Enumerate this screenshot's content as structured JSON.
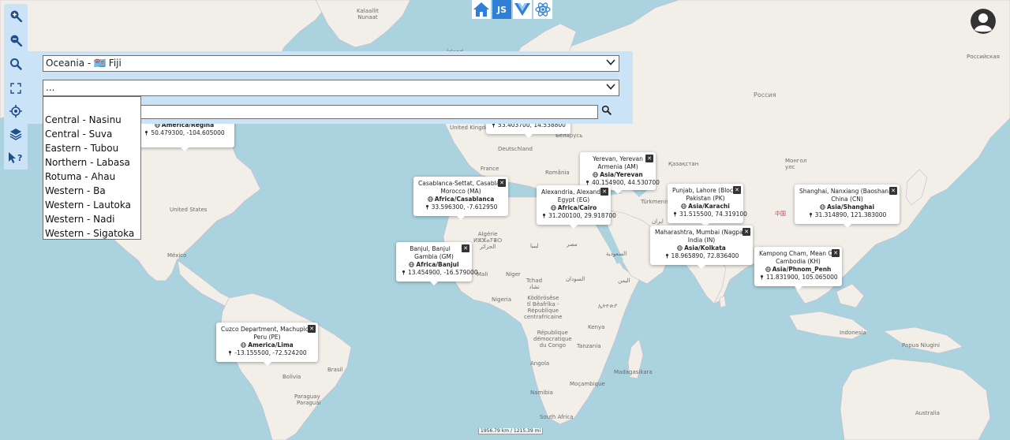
{
  "top_icons": [
    {
      "name": "home-icon"
    },
    {
      "name": "javascript-icon",
      "label": "JS"
    },
    {
      "name": "vue-icon"
    },
    {
      "name": "react-icon"
    }
  ],
  "panel": {
    "region_select_value": "Oceania - 🇫🇯 Fiji",
    "subregion_select_value": "...",
    "search_value": ""
  },
  "dropdown": {
    "options": [
      "Central - Nasinu",
      "Central - Suva",
      "Eastern - Tubou",
      "Northern - Labasa",
      "Rotuma - Ahau",
      "Western - Ba",
      "Western - Lautoka",
      "Western - Nadi",
      "Western - Sigatoka"
    ]
  },
  "popups": [
    {
      "id": "regina",
      "title": "",
      "tz": "America/Regina",
      "coords": "50.479300, -104.605000"
    },
    {
      "id": "europe",
      "title": "",
      "tz": "",
      "coords": "53.403700, 14.538800"
    },
    {
      "id": "yerevan",
      "title": "Yerevan, Yerevan",
      "country": "Armenia (AM)",
      "tz": "Asia/Yerevan",
      "coords": "40.154900, 44.530700"
    },
    {
      "id": "casablanca",
      "title": "Casablanca-Settat, Casablanca",
      "country": "Morocco (MA)",
      "tz": "Africa/Casablanca",
      "coords": "33.596300, -7.612950"
    },
    {
      "id": "alexandria",
      "title": "Alexandria, Alexandria",
      "country": "Egypt (EG)",
      "tz": "Africa/Cairo",
      "coords": "31.200100, 29.918700"
    },
    {
      "id": "lahore",
      "title": "Punjab, Lahore (Block",
      "country": "Pakistan (PK)",
      "tz": "Asia/Karachi",
      "coords": "31.515500, 74.319100"
    },
    {
      "id": "shanghai",
      "title": "Shanghai, Nanxiang (Baoshan C",
      "country": "China (CN)",
      "tz": "Asia/Shanghai",
      "coords": "31.314890, 121.383000"
    },
    {
      "id": "mumbai",
      "title": "Maharashtra, Mumbai (Nagpa",
      "country": "India (IN)",
      "tz": "Asia/Kolkata",
      "coords": "18.965890, 72.836400"
    },
    {
      "id": "banjul",
      "title": "Banjul, Banjul",
      "country": "Gambia (GM)",
      "tz": "Africa/Banjul",
      "coords": "13.454900, -16.579000"
    },
    {
      "id": "kampong",
      "title": "Kampong Cham, Mean Ch",
      "country": "Cambodia (KH)",
      "tz": "Asia/Phnom_Penh",
      "coords": "11.831900, 105.065000"
    },
    {
      "id": "cuzco",
      "title": "Cuzco Department, Machupicch",
      "country": "Peru (PE)",
      "tz": "America/Lima",
      "coords": "-13.155500, -72.524200"
    }
  ],
  "map_labels": [
    {
      "id": "kalaallit",
      "text": "Kalaallit\nNunaat"
    },
    {
      "id": "iceland",
      "text": "Ísland"
    },
    {
      "id": "russia",
      "text": "Россия"
    },
    {
      "id": "russia2",
      "text": "Российская"
    },
    {
      "id": "uk",
      "text": "United Kingdom"
    },
    {
      "id": "belarus",
      "text": "Беларусь"
    },
    {
      "id": "deutschland",
      "text": "Deutschland"
    },
    {
      "id": "france",
      "text": "France"
    },
    {
      "id": "romania",
      "text": "România"
    },
    {
      "id": "kazakhstan",
      "text": "Қазақстан"
    },
    {
      "id": "mongolia",
      "text": "Монгол\nулс"
    },
    {
      "id": "turkmenistan",
      "text": "Türkmenistan"
    },
    {
      "id": "iran",
      "text": "ایران"
    },
    {
      "id": "china",
      "text": "中国"
    },
    {
      "id": "usa",
      "text": "United States"
    },
    {
      "id": "mexico",
      "text": "México"
    },
    {
      "id": "algeria",
      "text": "Algérie\nⵍⵣⵣⴰⵢⴻⵔ\nالجزائر"
    },
    {
      "id": "libya",
      "text": "ليبيا"
    },
    {
      "id": "egypt",
      "text": "مصر"
    },
    {
      "id": "saudi",
      "text": "السعودية"
    },
    {
      "id": "mali",
      "text": "Mali"
    },
    {
      "id": "niger",
      "text": "Niger"
    },
    {
      "id": "tchad",
      "text": "Tchad\nتشاد"
    },
    {
      "id": "sudan",
      "text": "السودان"
    },
    {
      "id": "yemen",
      "text": "اليمن"
    },
    {
      "id": "ethiopia",
      "text": "ኢትዮጵያ"
    },
    {
      "id": "nigeria",
      "text": "Nigeria"
    },
    {
      "id": "car",
      "text": "Ködörösêse\ntî Bêafrîka -\nRépublique\ncentrafricaine"
    },
    {
      "id": "kenya",
      "text": "Kenya"
    },
    {
      "id": "drc",
      "text": "République\ndémocratique\ndu Congo"
    },
    {
      "id": "tanzania",
      "text": "Tanzania"
    },
    {
      "id": "angola",
      "text": "Angola"
    },
    {
      "id": "namibia",
      "text": "Namibia"
    },
    {
      "id": "mocambique",
      "text": "Moçambique"
    },
    {
      "id": "madagascar",
      "text": "Madagasikara"
    },
    {
      "id": "south-africa",
      "text": "South Africa"
    },
    {
      "id": "brasil",
      "text": "Brasil"
    },
    {
      "id": "bolivia",
      "text": "Bolivia"
    },
    {
      "id": "paraguay",
      "text": "Paraguay"
    },
    {
      "id": "paraguay2",
      "text": "Paraguái"
    },
    {
      "id": "indonesia",
      "text": "Indonesia"
    },
    {
      "id": "png",
      "text": "Papua Niugini"
    },
    {
      "id": "australia",
      "text": "Australia"
    }
  ],
  "scale_text": "1956.79 km / 1215.39 mi"
}
